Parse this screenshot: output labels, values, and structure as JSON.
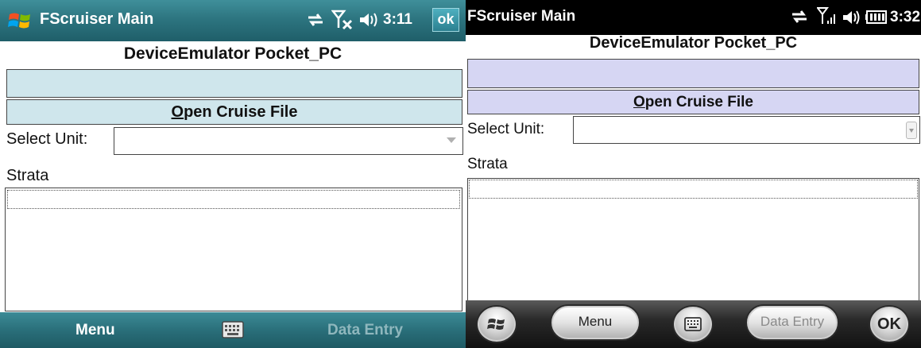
{
  "screen1": {
    "title": "FScruiser Main",
    "time": "3:11",
    "ok_label": "ok",
    "device_name": "DeviceEmulator Pocket_PC",
    "open_cruise_file_label": "Open Cruise File",
    "select_unit_label": "Select Unit:",
    "select_unit_value": "",
    "strata_label": "Strata",
    "softkey_left": "Menu",
    "softkey_right": "Data Entry",
    "colors": {
      "titlebar": "#2d7580",
      "band": "#cfe6ec"
    }
  },
  "screen2": {
    "title": "FScruiser Main",
    "time": "3:32",
    "device_name": "DeviceEmulator Pocket_PC",
    "open_cruise_file_label": "Open Cruise File",
    "select_unit_label": "Select Unit:",
    "select_unit_value": "",
    "strata_label": "Strata",
    "menu_button_label": "Menu",
    "data_entry_button_label": "Data Entry",
    "ok_label": "OK",
    "colors": {
      "titlebar": "#000000",
      "band": "#d6d6f3"
    }
  },
  "icons": [
    "windows-flag-icon",
    "sync-icon",
    "signal-icon",
    "volume-icon",
    "battery-icon",
    "keyboard-icon"
  ]
}
